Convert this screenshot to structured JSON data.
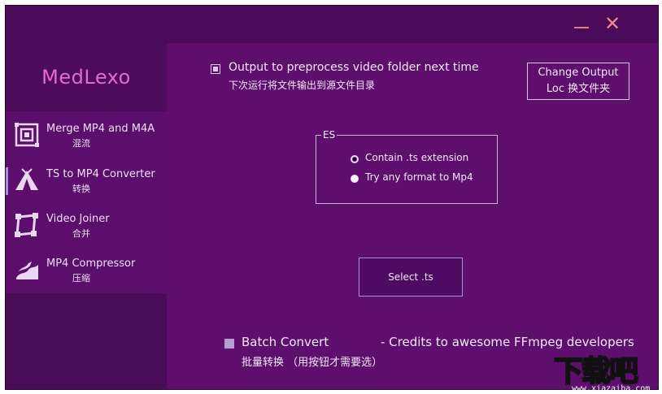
{
  "window": {
    "minimize_glyph": "—",
    "close_glyph": "✕",
    "colors": {
      "background": "#5e0f6e",
      "sidebar": "#4a0b58",
      "logo": "#e46bd0",
      "close": "#f08a8a"
    }
  },
  "app": {
    "name": "MedLexo"
  },
  "sidebar": {
    "items": [
      {
        "label": "Merge MP4 and M4A",
        "sublabel": "混流",
        "icon": "merge-icon",
        "active": false
      },
      {
        "label": "TS to MP4 Converter",
        "sublabel": "转换",
        "icon": "tent-icon",
        "active": true
      },
      {
        "label": "Video Joiner",
        "sublabel": "合并",
        "icon": "crop-frame-icon",
        "active": false
      },
      {
        "label": "MP4 Compressor",
        "sublabel": "压缩",
        "icon": "compress-icon",
        "active": false
      }
    ]
  },
  "main": {
    "output_option": {
      "label": "Output to preprocess video folder next time",
      "sublabel": "下次运行将文件输出到源文件目录",
      "checked": true
    },
    "change_output_button": {
      "line1": "Change Output",
      "line2": "Loc 换文件夹"
    },
    "es_group": {
      "legend": "ES",
      "options": [
        {
          "label": "Contain .ts extension",
          "selected": true
        },
        {
          "label": "Try any format to Mp4",
          "selected": false
        }
      ]
    },
    "select_button": {
      "label": "Select .ts"
    },
    "batch_convert": {
      "label": "Batch Convert",
      "sublabel": "批量转换 （用按钮才需要选）",
      "checked": false
    },
    "credits": "- Credits to awesome FFmpeg developers"
  },
  "watermark": {
    "text": "下载吧",
    "url": "www.xiazaiba.com"
  }
}
